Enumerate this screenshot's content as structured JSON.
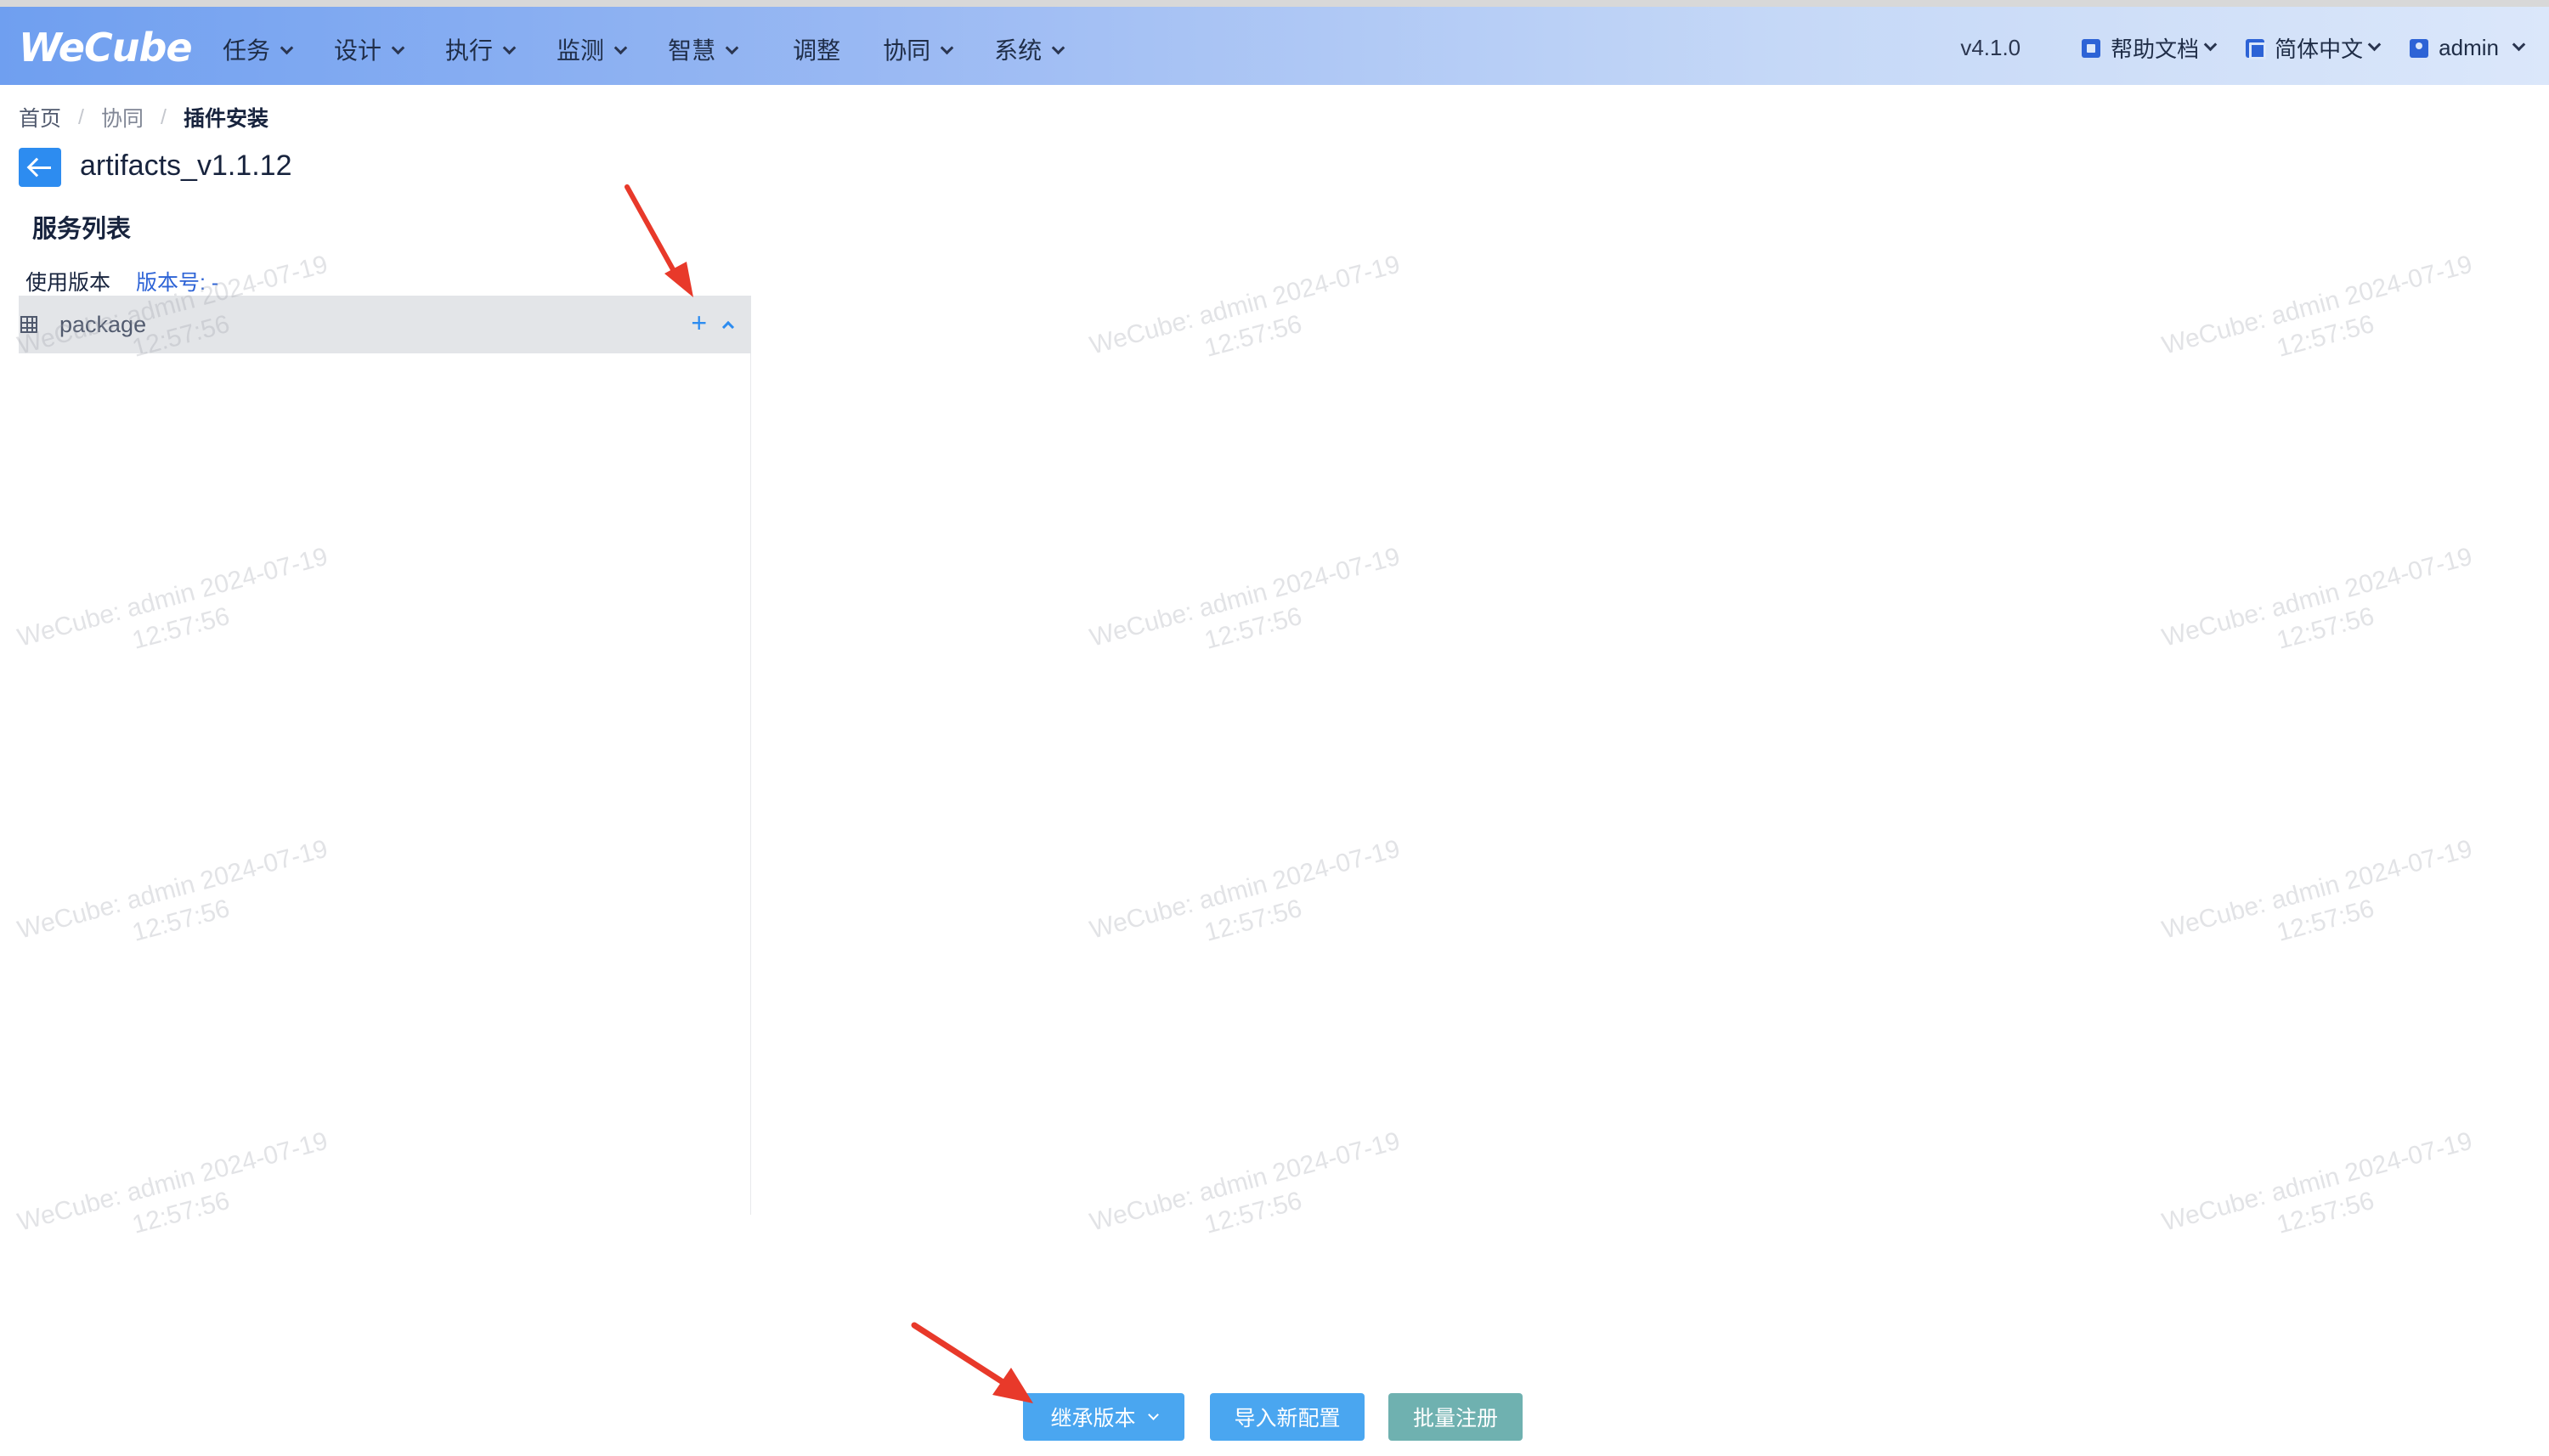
{
  "header": {
    "logo": "WeCube",
    "nav": [
      {
        "label": "任务",
        "dropdown": true
      },
      {
        "label": "设计",
        "dropdown": true
      },
      {
        "label": "执行",
        "dropdown": true
      },
      {
        "label": "监测",
        "dropdown": true
      },
      {
        "label": "智慧",
        "dropdown": true
      },
      {
        "label": "调整",
        "dropdown": false
      },
      {
        "label": "协同",
        "dropdown": true
      },
      {
        "label": "系统",
        "dropdown": true
      }
    ],
    "version": "v4.1.0",
    "help": "帮助文档",
    "language": "简体中文",
    "user": "admin"
  },
  "breadcrumb": [
    "首页",
    "协同",
    "插件安装"
  ],
  "page": {
    "title": "artifacts_v1.1.12",
    "service_heading": "服务列表",
    "version_label": "使用版本",
    "version_value": "版本号: -"
  },
  "services": [
    {
      "name": "package",
      "add_icon": "+"
    }
  ],
  "watermark": {
    "line1": "WeCube: admin 2024-07-19",
    "line2": "12:57:56"
  },
  "buttons": {
    "inherit": "继承版本",
    "import": "导入新配置",
    "batch": "批量注册"
  },
  "colors": {
    "accent": "#2d8cf0",
    "button_blue": "#4aa6f0",
    "button_teal": "#6fb1b0",
    "annotation_red": "#e8392a"
  }
}
